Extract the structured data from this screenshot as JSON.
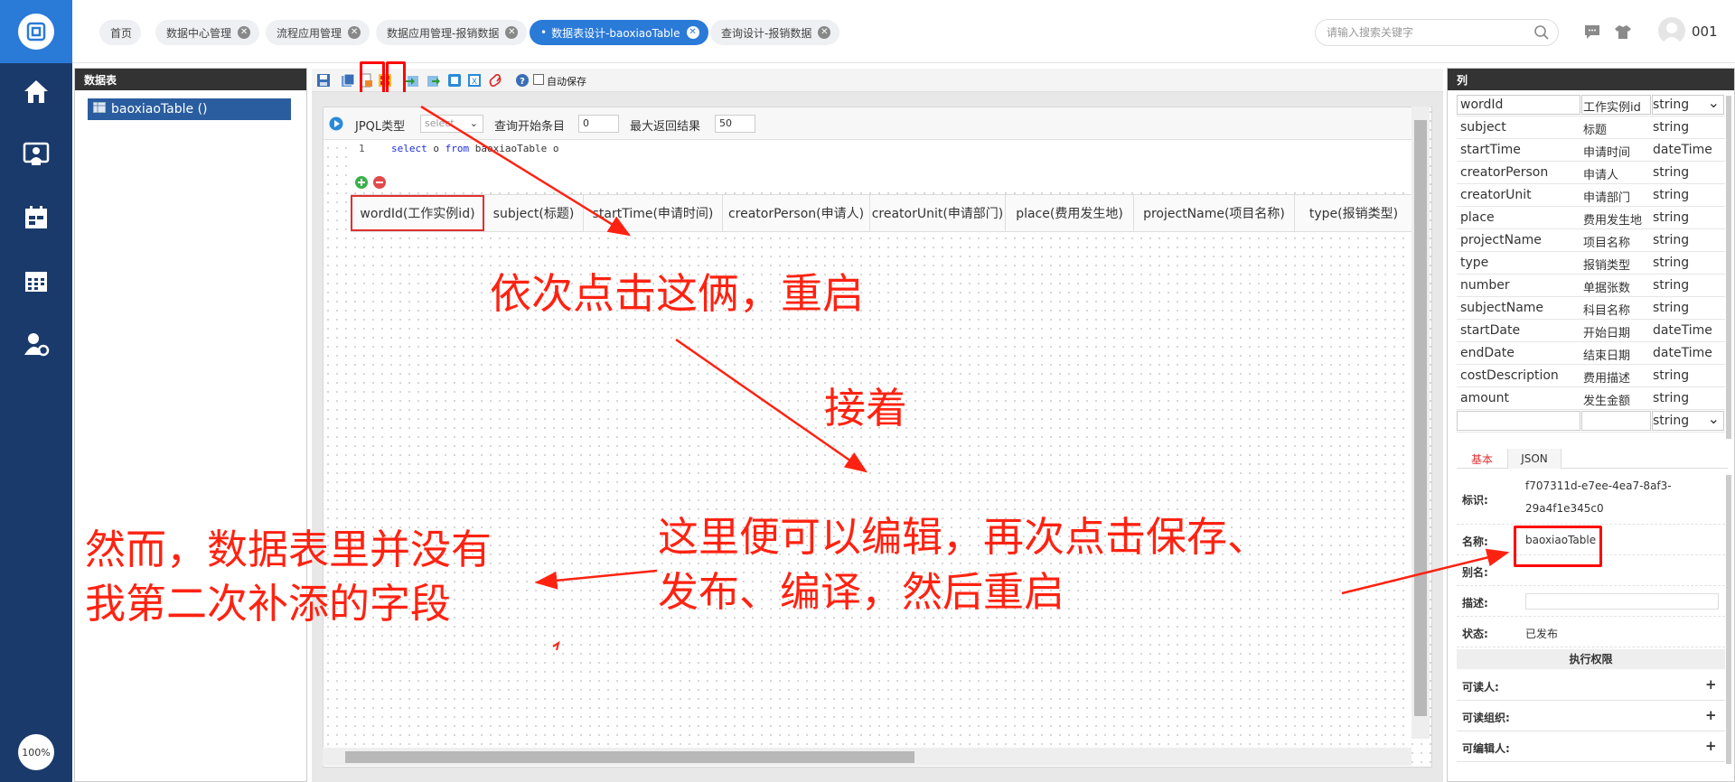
{
  "tabs": [
    {
      "label": "首页",
      "closable": false
    },
    {
      "label": "数据中心管理",
      "closable": true
    },
    {
      "label": "流程应用管理",
      "closable": true
    },
    {
      "label": "数据应用管理-报销数据",
      "closable": true
    },
    {
      "label": "数据表设计-baoxiaoTable",
      "closable": true,
      "active": true
    },
    {
      "label": "查询设计-报销数据",
      "closable": true
    }
  ],
  "search": {
    "placeholder": "请输入搜索关键字"
  },
  "user": {
    "name": "001"
  },
  "zoom": "100%",
  "datatable_panel": {
    "title": "数据表",
    "item": "baoxiaoTable ()"
  },
  "toolbar": {
    "autosave_label": "自动保存"
  },
  "query": {
    "type_label": "JPQL类型",
    "type_value": "select",
    "start_label": "查询开始条目",
    "start_value": "0",
    "max_label": "最大返回结果",
    "max_value": "50",
    "line_no": "1",
    "code_kw1": "select",
    "code_mid": " o ",
    "code_kw2": "from",
    "code_rest": " baoxiaoTable o"
  },
  "columns_header": [
    "wordId(工作实例id)",
    "subject(标题)",
    "startTime(申请时间)",
    "creatorPerson(申请人)",
    "creatorUnit(申请部门)",
    "place(费用发生地)",
    "projectName(项目名称)",
    "type(报销类型)"
  ],
  "column_panel": {
    "title": "列",
    "rows": [
      {
        "name": "wordId",
        "desc": "工作实例id",
        "type": "string"
      },
      {
        "name": "subject",
        "desc": "标题",
        "type": "string"
      },
      {
        "name": "startTime",
        "desc": "申请时间",
        "type": "dateTime"
      },
      {
        "name": "creatorPerson",
        "desc": "申请人",
        "type": "string"
      },
      {
        "name": "creatorUnit",
        "desc": "申请部门",
        "type": "string"
      },
      {
        "name": "place",
        "desc": "费用发生地",
        "type": "string"
      },
      {
        "name": "projectName",
        "desc": "项目名称",
        "type": "string"
      },
      {
        "name": "type",
        "desc": "报销类型",
        "type": "string"
      },
      {
        "name": "number",
        "desc": "单据张数",
        "type": "string"
      },
      {
        "name": "subjectName",
        "desc": "科目名称",
        "type": "string"
      },
      {
        "name": "startDate",
        "desc": "开始日期",
        "type": "dateTime"
      },
      {
        "name": "endDate",
        "desc": "结束日期",
        "type": "dateTime"
      },
      {
        "name": "costDescription",
        "desc": "费用描述",
        "type": "string"
      },
      {
        "name": "amount",
        "desc": "发生金额",
        "type": "string"
      },
      {
        "name": "",
        "desc": "",
        "type": "string"
      }
    ]
  },
  "props": {
    "tab_basic": "基本",
    "tab_json": "JSON",
    "id_label": "标识:",
    "id_value_1": "f707311d-e7ee-4ea7-8af3-",
    "id_value_2": "29a4f1e345c0",
    "name_label": "名称:",
    "name_value": "baoxiaoTable",
    "alias_label": "别名:",
    "desc_label": "描述:",
    "status_label": "状态:",
    "status_value": "已发布",
    "perm_title": "执行权限",
    "readers": "可读人:",
    "read_groups": "可读组织:",
    "editors": "可编辑人:",
    "plus": "+"
  },
  "annotations": {
    "a1": "依次点击这俩，重启",
    "a2": "接着",
    "a3_1": "这里便可以编辑，再次点击保存、",
    "a3_2": "发布、编译，然后重启",
    "a4_1": "然而，数据表里并没有",
    "a4_2": "我第二次补添的字段"
  },
  "colors": {
    "nav": "#1a3a6b",
    "accent": "#2a7ad8",
    "annotation": "#ff2211"
  }
}
